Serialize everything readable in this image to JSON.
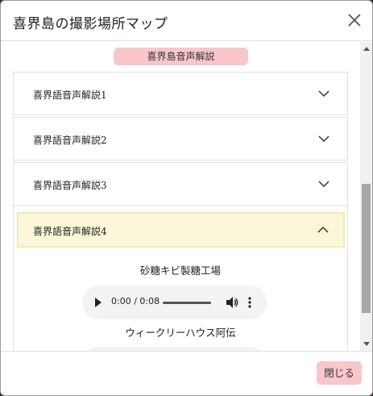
{
  "modal": {
    "title": "喜界島の撮影場所マップ",
    "close_icon": "close-icon"
  },
  "body": {
    "section_pill": "喜界島音声解説",
    "accordion": [
      {
        "label": "喜界語音声解説1",
        "expanded": false,
        "icon": "chevron-down-icon"
      },
      {
        "label": "喜界語音声解説2",
        "expanded": false,
        "icon": "chevron-down-icon"
      },
      {
        "label": "喜界語音声解説3",
        "expanded": false,
        "icon": "chevron-down-icon"
      },
      {
        "label": "喜界語音声解説4",
        "expanded": true,
        "icon": "chevron-up-icon"
      }
    ],
    "tracks": [
      {
        "title": "砂糖キビ製糖工場",
        "time": "0:00 / 0:08"
      },
      {
        "title": "ウィークリーハウス阿伝",
        "time": ""
      }
    ]
  },
  "footer": {
    "close_button": "閉じる"
  },
  "colors": {
    "pill_bg": "#f8c6cb",
    "open_header_bg": "#fbf7d8",
    "audio_bg": "#f1f3f4"
  }
}
